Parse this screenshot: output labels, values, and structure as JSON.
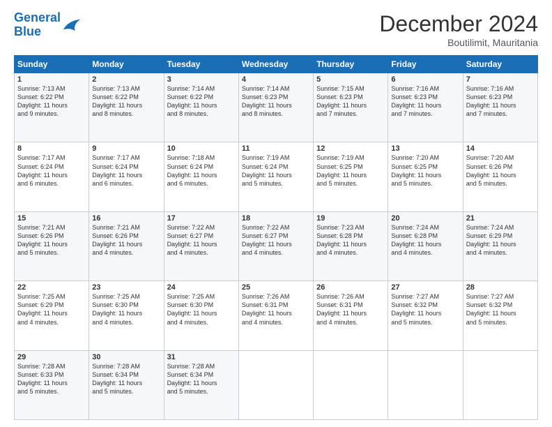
{
  "logo": {
    "line1": "General",
    "line2": "Blue"
  },
  "title": "December 2024",
  "subtitle": "Boutilimit, Mauritania",
  "days_header": [
    "Sunday",
    "Monday",
    "Tuesday",
    "Wednesday",
    "Thursday",
    "Friday",
    "Saturday"
  ],
  "weeks": [
    [
      {
        "day": "1",
        "info": "Sunrise: 7:13 AM\nSunset: 6:22 PM\nDaylight: 11 hours\nand 9 minutes."
      },
      {
        "day": "2",
        "info": "Sunrise: 7:13 AM\nSunset: 6:22 PM\nDaylight: 11 hours\nand 8 minutes."
      },
      {
        "day": "3",
        "info": "Sunrise: 7:14 AM\nSunset: 6:22 PM\nDaylight: 11 hours\nand 8 minutes."
      },
      {
        "day": "4",
        "info": "Sunrise: 7:14 AM\nSunset: 6:23 PM\nDaylight: 11 hours\nand 8 minutes."
      },
      {
        "day": "5",
        "info": "Sunrise: 7:15 AM\nSunset: 6:23 PM\nDaylight: 11 hours\nand 7 minutes."
      },
      {
        "day": "6",
        "info": "Sunrise: 7:16 AM\nSunset: 6:23 PM\nDaylight: 11 hours\nand 7 minutes."
      },
      {
        "day": "7",
        "info": "Sunrise: 7:16 AM\nSunset: 6:23 PM\nDaylight: 11 hours\nand 7 minutes."
      }
    ],
    [
      {
        "day": "8",
        "info": "Sunrise: 7:17 AM\nSunset: 6:24 PM\nDaylight: 11 hours\nand 6 minutes."
      },
      {
        "day": "9",
        "info": "Sunrise: 7:17 AM\nSunset: 6:24 PM\nDaylight: 11 hours\nand 6 minutes."
      },
      {
        "day": "10",
        "info": "Sunrise: 7:18 AM\nSunset: 6:24 PM\nDaylight: 11 hours\nand 6 minutes."
      },
      {
        "day": "11",
        "info": "Sunrise: 7:19 AM\nSunset: 6:24 PM\nDaylight: 11 hours\nand 5 minutes."
      },
      {
        "day": "12",
        "info": "Sunrise: 7:19 AM\nSunset: 6:25 PM\nDaylight: 11 hours\nand 5 minutes."
      },
      {
        "day": "13",
        "info": "Sunrise: 7:20 AM\nSunset: 6:25 PM\nDaylight: 11 hours\nand 5 minutes."
      },
      {
        "day": "14",
        "info": "Sunrise: 7:20 AM\nSunset: 6:26 PM\nDaylight: 11 hours\nand 5 minutes."
      }
    ],
    [
      {
        "day": "15",
        "info": "Sunrise: 7:21 AM\nSunset: 6:26 PM\nDaylight: 11 hours\nand 5 minutes."
      },
      {
        "day": "16",
        "info": "Sunrise: 7:21 AM\nSunset: 6:26 PM\nDaylight: 11 hours\nand 4 minutes."
      },
      {
        "day": "17",
        "info": "Sunrise: 7:22 AM\nSunset: 6:27 PM\nDaylight: 11 hours\nand 4 minutes."
      },
      {
        "day": "18",
        "info": "Sunrise: 7:22 AM\nSunset: 6:27 PM\nDaylight: 11 hours\nand 4 minutes."
      },
      {
        "day": "19",
        "info": "Sunrise: 7:23 AM\nSunset: 6:28 PM\nDaylight: 11 hours\nand 4 minutes."
      },
      {
        "day": "20",
        "info": "Sunrise: 7:24 AM\nSunset: 6:28 PM\nDaylight: 11 hours\nand 4 minutes."
      },
      {
        "day": "21",
        "info": "Sunrise: 7:24 AM\nSunset: 6:29 PM\nDaylight: 11 hours\nand 4 minutes."
      }
    ],
    [
      {
        "day": "22",
        "info": "Sunrise: 7:25 AM\nSunset: 6:29 PM\nDaylight: 11 hours\nand 4 minutes."
      },
      {
        "day": "23",
        "info": "Sunrise: 7:25 AM\nSunset: 6:30 PM\nDaylight: 11 hours\nand 4 minutes."
      },
      {
        "day": "24",
        "info": "Sunrise: 7:25 AM\nSunset: 6:30 PM\nDaylight: 11 hours\nand 4 minutes."
      },
      {
        "day": "25",
        "info": "Sunrise: 7:26 AM\nSunset: 6:31 PM\nDaylight: 11 hours\nand 4 minutes."
      },
      {
        "day": "26",
        "info": "Sunrise: 7:26 AM\nSunset: 6:31 PM\nDaylight: 11 hours\nand 4 minutes."
      },
      {
        "day": "27",
        "info": "Sunrise: 7:27 AM\nSunset: 6:32 PM\nDaylight: 11 hours\nand 5 minutes."
      },
      {
        "day": "28",
        "info": "Sunrise: 7:27 AM\nSunset: 6:32 PM\nDaylight: 11 hours\nand 5 minutes."
      }
    ],
    [
      {
        "day": "29",
        "info": "Sunrise: 7:28 AM\nSunset: 6:33 PM\nDaylight: 11 hours\nand 5 minutes."
      },
      {
        "day": "30",
        "info": "Sunrise: 7:28 AM\nSunset: 6:34 PM\nDaylight: 11 hours\nand 5 minutes."
      },
      {
        "day": "31",
        "info": "Sunrise: 7:28 AM\nSunset: 6:34 PM\nDaylight: 11 hours\nand 5 minutes."
      },
      null,
      null,
      null,
      null
    ]
  ]
}
